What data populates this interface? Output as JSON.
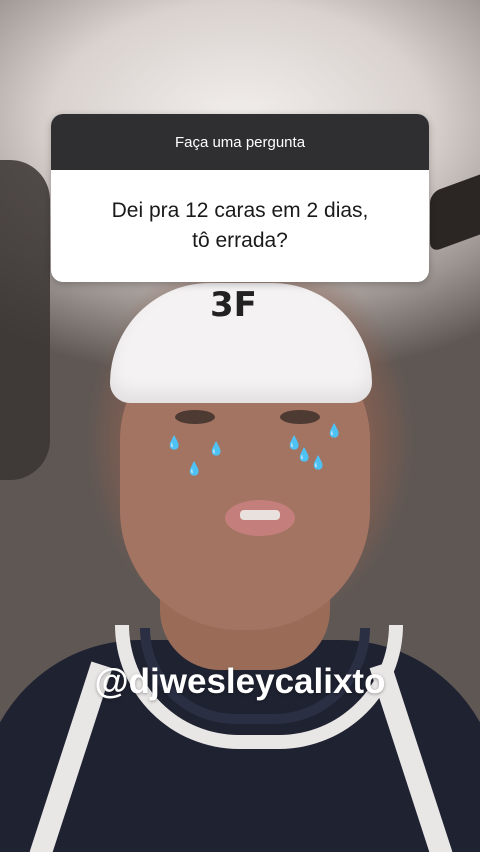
{
  "question_box": {
    "header": "Faça uma pergunta",
    "question_line1": "Dei pra 12 caras em 2 dias,",
    "question_line2": "tô errada?"
  },
  "mention": "@djwesleycalixto",
  "cap_logo_text": "3F",
  "colors": {
    "question_header_bg": "#2f2f31",
    "question_body_bg": "#ffffff",
    "mention_text": "#ffffff"
  }
}
